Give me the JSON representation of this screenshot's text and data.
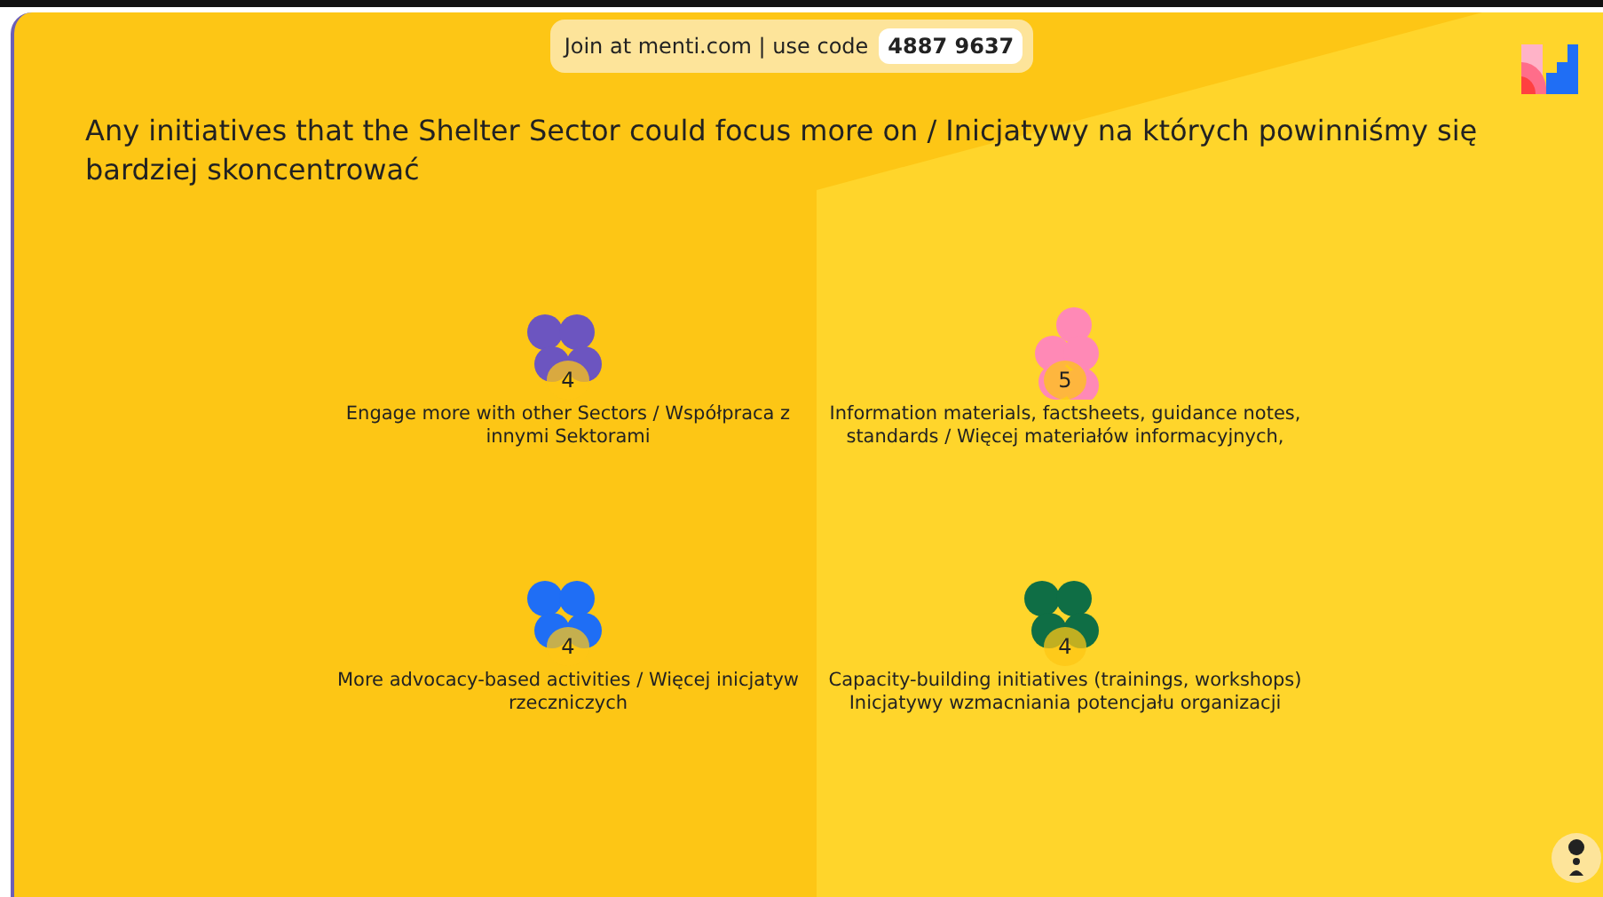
{
  "join_banner": {
    "text": "Join at menti.com | use code",
    "code": "4887 9637"
  },
  "question": "Any initiatives that the Shelter Sector could focus more on / Inicjatywy na których powinniśmy się bardziej skoncentrować",
  "answers": [
    {
      "label": "Engage more with other Sectors / Współpraca z innymi Sektorami",
      "count": "4",
      "color": "#6c55c0"
    },
    {
      "label": "Information materials, factsheets, guidance notes, standards / Więcej materiałów informacyjnych,",
      "count": "5",
      "color": "#ff89b6"
    },
    {
      "label": "More advocacy-based activities / Więcej inicjatyw rzeczniczych",
      "count": "4",
      "color": "#1f6ef5"
    },
    {
      "label": "Capacity-building initiatives (trainings, workshops) Inicjatywy wzmacniania potencjału organizacji",
      "count": "4",
      "color": "#0f6e45"
    }
  ]
}
